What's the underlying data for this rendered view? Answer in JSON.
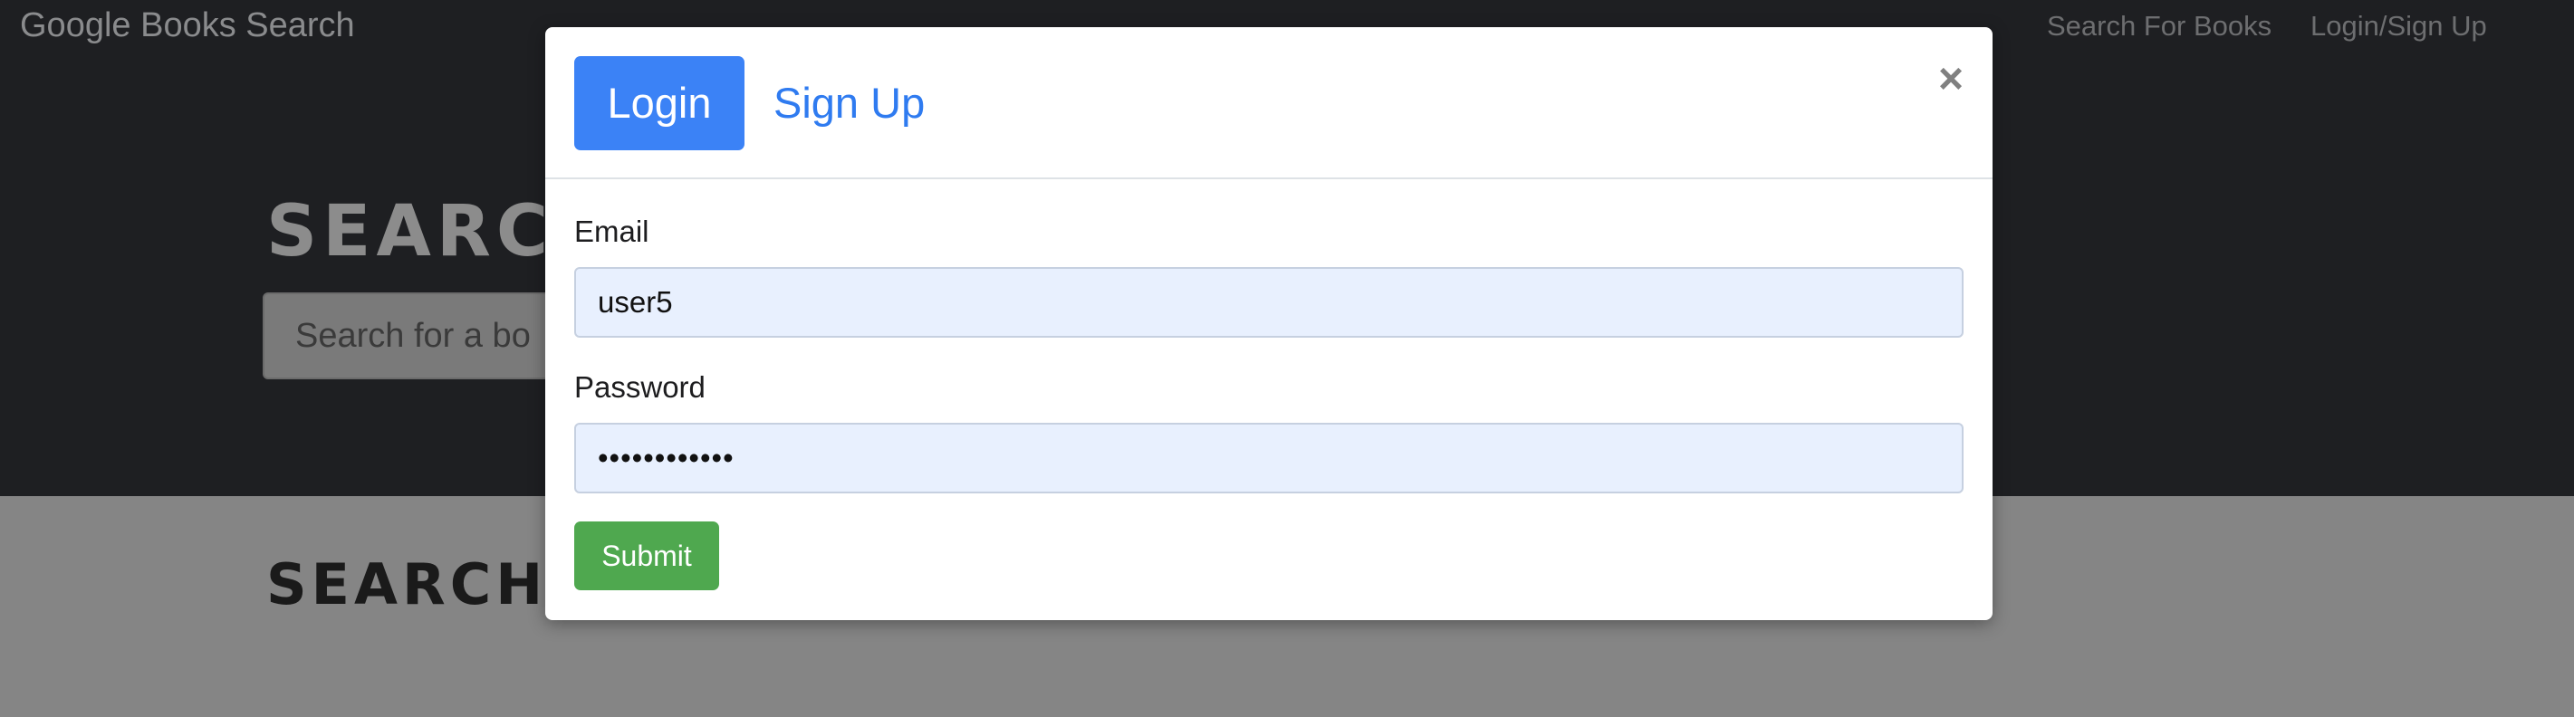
{
  "navbar": {
    "brand": "Google Books Search",
    "links": [
      "Search For Books",
      "Login/Sign Up"
    ]
  },
  "hero": {
    "title": "SEARC",
    "search_placeholder": "Search for a bo"
  },
  "results": {
    "title": "SEARCH"
  },
  "modal": {
    "tabs": {
      "login": "Login",
      "signup": "Sign Up"
    },
    "close_symbol": "×",
    "email_label": "Email",
    "email_value": "user5",
    "password_label": "Password",
    "password_masked": "••••••••••••",
    "submit_label": "Submit"
  },
  "colors": {
    "navbar_bg": "#1e1f22",
    "primary": "#3b82f6",
    "success": "#4fa84f",
    "autofill_bg": "#e8f0fe"
  }
}
